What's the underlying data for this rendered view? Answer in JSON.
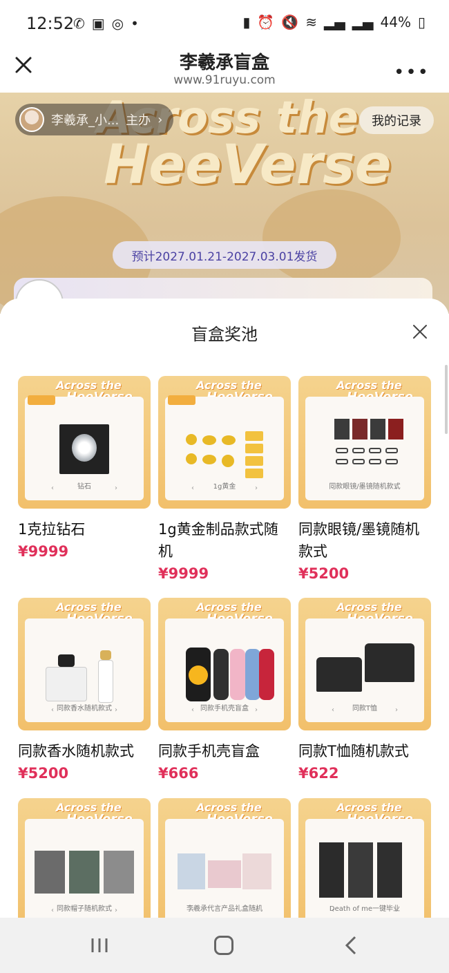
{
  "status_bar": {
    "time": "12:52",
    "battery": "44%"
  },
  "header": {
    "title": "李羲承盲盒",
    "url": "www.91ruyu.com"
  },
  "banner": {
    "host_name": "李羲承_小...",
    "host_role": "主办",
    "my_records": "我的记录",
    "shipping": "预计2027.01.21-2027.03.01发货",
    "art_line1": "Across the",
    "art_line2": "HeeVerse"
  },
  "sheet": {
    "title": "盲盒奖池"
  },
  "thumb_common": {
    "logo1": "Across the",
    "logo2": "HeeVerse"
  },
  "items": [
    {
      "name": "1克拉钻石",
      "price": "¥9999",
      "caption": "钻石"
    },
    {
      "name": "1g黄金制品款式随机",
      "price": "¥9999",
      "caption": "1g黄金"
    },
    {
      "name": "同款眼镜/墨镜随机款式",
      "price": "¥5200",
      "caption": "同款眼镜/墨镜随机款式"
    },
    {
      "name": "同款香水随机款式",
      "price": "¥5200",
      "caption": "同款香水随机款式"
    },
    {
      "name": "同款手机壳盲盒",
      "price": "¥666",
      "caption": "同款手机壳盲盒"
    },
    {
      "name": "同款T恤随机款式",
      "price": "¥622",
      "caption": "同款T恤"
    },
    {
      "name": "",
      "price": "",
      "caption": "同款帽子随机款式"
    },
    {
      "name": "",
      "price": "",
      "caption": "李羲承代言产品礼盒随机"
    },
    {
      "name": "",
      "price": "",
      "caption": "Death of me一键毕业"
    }
  ],
  "colors": {
    "price": "#e0305a",
    "ship_text": "#4b42a3",
    "thumb_orange": "#f2c06b"
  }
}
